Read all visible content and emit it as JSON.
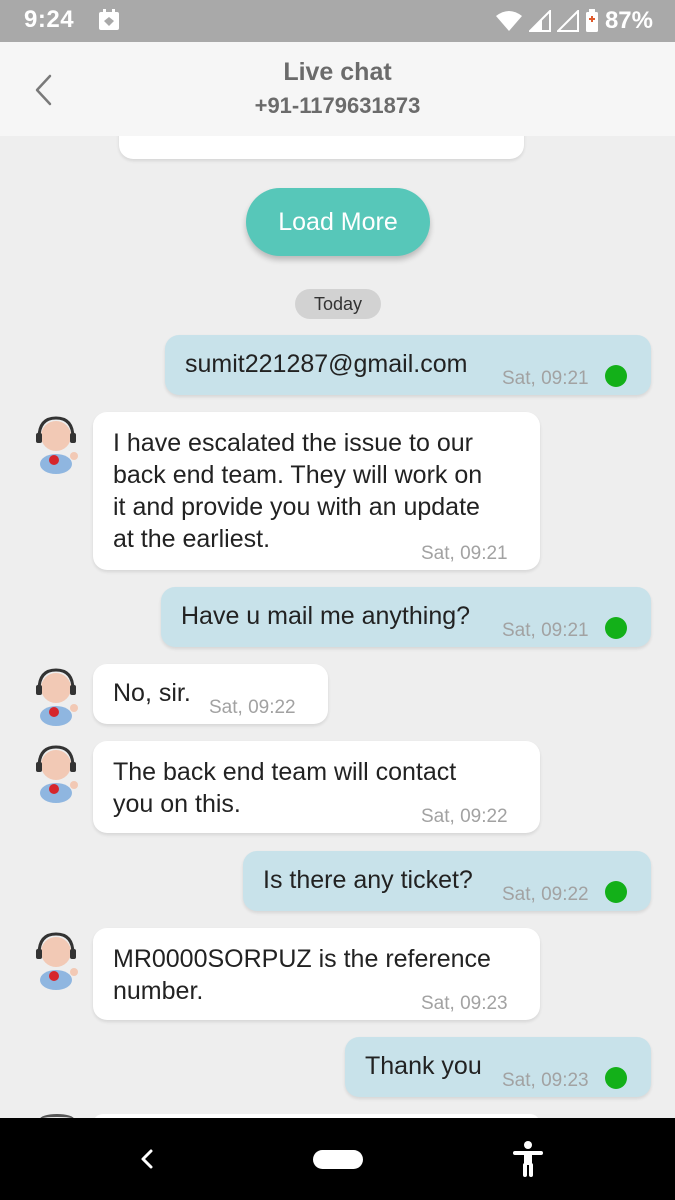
{
  "status_bar": {
    "time": "9:24",
    "battery": "87%",
    "icons": [
      "notification-icon",
      "wifi-icon",
      "signal-icon",
      "signal-empty-icon",
      "battery-icon"
    ]
  },
  "header": {
    "title": "Live chat",
    "subtitle": "+91-1179631873",
    "back_icon": "chevron-left-icon"
  },
  "chat": {
    "load_more": "Load More",
    "date_divider": "Today",
    "accent_color": "#57c7b9",
    "outgoing_color": "#c8e2ea",
    "delivered_color": "#13b019",
    "messages": [
      {
        "direction": "out",
        "text": "sumit221287@gmail.com",
        "time": "Sat, 09:21"
      },
      {
        "direction": "in",
        "lines": [
          "I have escalated the issue to our",
          "back end team. They will work on",
          "it and provide you with an update",
          "at the earliest."
        ],
        "time": "Sat, 09:21"
      },
      {
        "direction": "out",
        "text": "Have u mail me anything?",
        "time": "Sat, 09:21"
      },
      {
        "direction": "in",
        "lines": [
          "No, sir."
        ],
        "time": "Sat, 09:22"
      },
      {
        "direction": "in",
        "lines": [
          "The back end team will contact",
          "you on this."
        ],
        "time": "Sat, 09:22"
      },
      {
        "direction": "out",
        "text": "Is there any ticket?",
        "time": "Sat, 09:22"
      },
      {
        "direction": "in",
        "lines": [
          "MR0000SORPUZ is the reference",
          "number."
        ],
        "time": "Sat, 09:23"
      },
      {
        "direction": "out",
        "text": "Thank you",
        "time": "Sat, 09:23"
      }
    ]
  },
  "nav_bar": {
    "icons": [
      "nav-back-icon",
      "home-pill-icon",
      "accessibility-icon"
    ]
  }
}
